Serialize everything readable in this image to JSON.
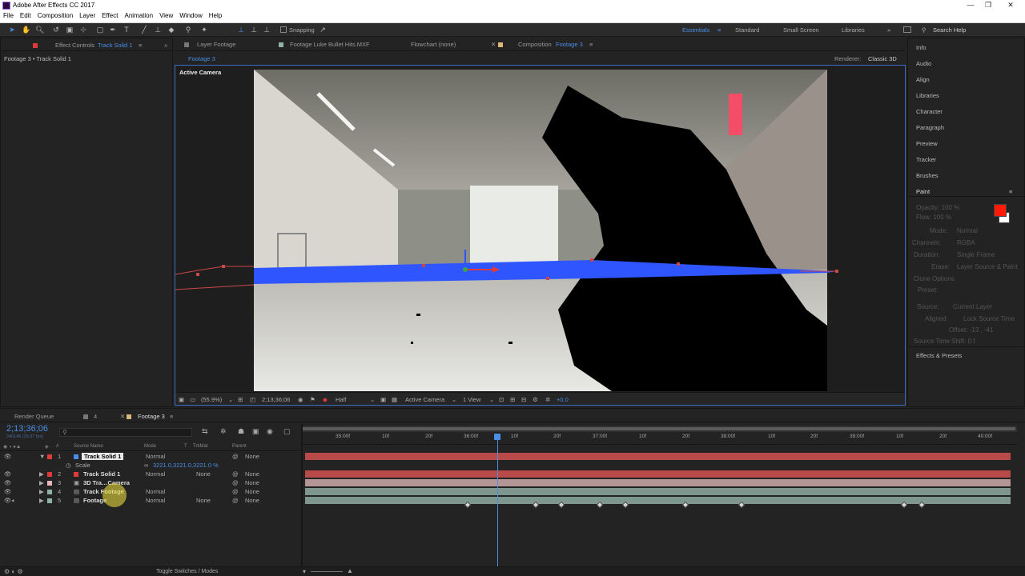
{
  "window": {
    "title": "Adobe After Effects CC 2017"
  },
  "menu": [
    "File",
    "Edit",
    "Composition",
    "Layer",
    "Effect",
    "Animation",
    "View",
    "Window",
    "Help"
  ],
  "toolbar": {
    "snapping_label": "Snapping",
    "workspaces": [
      "Essentials",
      "Standard",
      "Small Screen",
      "Libraries"
    ],
    "search_placeholder": "Search Help"
  },
  "left_panel": {
    "tab_prefix": "Effect Controls",
    "tab_layer": "Track Solid 1",
    "breadcrumb": "Footage 3 • Track Solid 1"
  },
  "comp_tabs": {
    "layer": "Layer Footage",
    "footage": "Footage Luke Bullet Hits.MXF",
    "flowchart": "Flowchart (none)",
    "composition_prefix": "Composition",
    "composition_name": "Footage 3",
    "subtab": "Footage 3",
    "renderer_label": "Renderer:",
    "renderer_value": "Classic 3D"
  },
  "viewer": {
    "view_label": "Active Camera",
    "footer": {
      "zoom": "(55.9%)",
      "timecode": "2;13;36;06",
      "resolution": "Half",
      "camera": "Active Camera",
      "views": "1 View",
      "exposure": "+0.0"
    }
  },
  "right_panel": {
    "items": [
      "Info",
      "Audio",
      "Align",
      "Libraries",
      "Character",
      "Paragraph",
      "Preview",
      "Tracker",
      "Brushes",
      "Paint"
    ],
    "paint": {
      "opacity": "Opacity: 100 %",
      "flow": "Flow: 100 %",
      "mode": "Mode:",
      "mode_value": "Normal",
      "channels": "Channels:",
      "channels_value": "RGBA",
      "duration": "Duration:",
      "duration_value": "Single Frame",
      "erase": "Erase:",
      "erase_value": "Layer Source & Paint",
      "clone_options": "Clone Options",
      "preset": "Preset:",
      "source": "Source:",
      "source_value": "Current Layer",
      "aligned": "Aligned",
      "lock_source_time": "Lock Source Time",
      "offset": "Offset: -13 , -41",
      "source_time_shift": "Source Time Shift: 0 f"
    },
    "effects_presets": "Effects & Presets",
    "colors": {
      "foreground": "#ff1a0a",
      "background": "#ffffff"
    }
  },
  "timeline": {
    "tabs": [
      "Render Queue",
      "4",
      "Footage 3"
    ],
    "current_time": "2;13;36;06",
    "fps_info": "240146 (29.97 fps)",
    "column_headers": {
      "source_name": "Source Name",
      "mode": "Mode",
      "t": "T",
      "trkmat": "TrkMat",
      "parent": "Parent"
    },
    "layers": [
      {
        "num": "1",
        "name": "Track Solid 1",
        "mode": "Normal",
        "trkmat": "",
        "parent": "None",
        "color": "#e03b3b"
      },
      {
        "num": "",
        "name": "Scale",
        "mode": "3221.0,3221.0,3221.0 %",
        "trkmat": "",
        "parent": "",
        "color": ""
      },
      {
        "num": "2",
        "name": "Track Solid 1",
        "mode": "Normal",
        "trkmat": "None",
        "parent": "None",
        "color": "#e03b3b"
      },
      {
        "num": "3",
        "name": "3D Tra…Camera",
        "mode": "",
        "trkmat": "",
        "parent": "None",
        "color": "#e8b7b7"
      },
      {
        "num": "4",
        "name": "Track Footage",
        "mode": "Normal",
        "trkmat": "",
        "parent": "None",
        "color": "#8fb3a6"
      },
      {
        "num": "5",
        "name": "Footage",
        "mode": "Normal",
        "trkmat": "None",
        "parent": "None",
        "color": "#8fb3a6"
      }
    ],
    "ruler": [
      "35:00f",
      "10f",
      "20f",
      "36:00f",
      "10f",
      "20f",
      "37:00f",
      "10f",
      "20f",
      "38:00f",
      "10f",
      "20f",
      "39:00f",
      "10f",
      "20f",
      "40:00f"
    ],
    "footer_label": "Toggle Switches / Modes"
  }
}
